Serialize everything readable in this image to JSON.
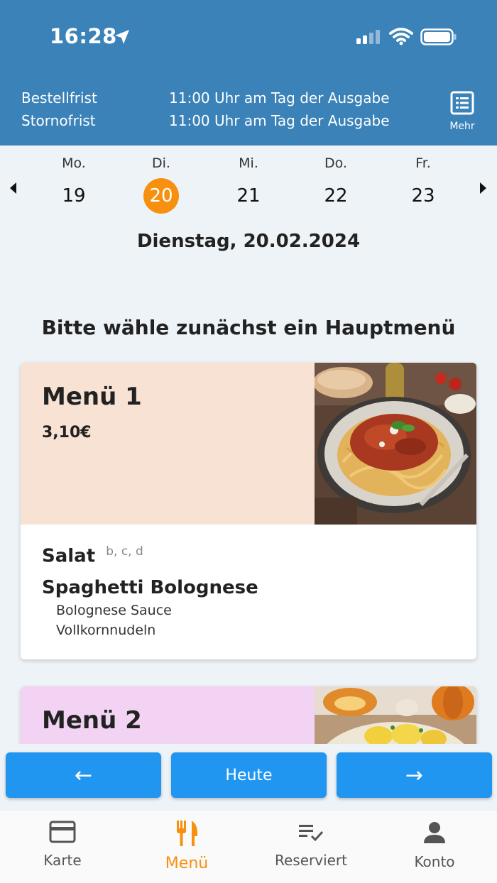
{
  "status": {
    "time": "16:28"
  },
  "header": {
    "rows": [
      {
        "label": "Bestellfrist",
        "value": "11:00 Uhr am Tag der Ausgabe"
      },
      {
        "label": "Stornofrist",
        "value": "11:00 Uhr am Tag der Ausgabe"
      }
    ],
    "more_label": "Mehr"
  },
  "week": {
    "days": [
      {
        "name": "Mo.",
        "num": "19"
      },
      {
        "name": "Di.",
        "num": "20"
      },
      {
        "name": "Mi.",
        "num": "21"
      },
      {
        "name": "Do.",
        "num": "22"
      },
      {
        "name": "Fr.",
        "num": "23"
      }
    ],
    "selected_index": 1
  },
  "date_title": "Dienstag, 20.02.2024",
  "section_title": "Bitte wähle zunächst ein Hauptmenü",
  "menus": [
    {
      "title": "Menü 1",
      "price": "3,10€",
      "color": "#f8e2d4",
      "side": "Salat",
      "allergens": "b, c, d",
      "main": "Spaghetti Bolognese",
      "components": [
        "Bolognese Sauce",
        "Vollkornnudeln"
      ]
    },
    {
      "title": "Menü 2",
      "color": "#f3d3f3"
    }
  ],
  "buttons": {
    "prev": "←",
    "today": "Heute",
    "next": "→"
  },
  "tabs": [
    {
      "label": "Karte",
      "icon": "card-icon"
    },
    {
      "label": "Menü",
      "icon": "cutlery-icon"
    },
    {
      "label": "Reserviert",
      "icon": "checklist-icon"
    },
    {
      "label": "Konto",
      "icon": "person-icon"
    }
  ],
  "colors": {
    "header": "#3a82b8",
    "accent": "#f7900f",
    "button": "#2196f0"
  }
}
